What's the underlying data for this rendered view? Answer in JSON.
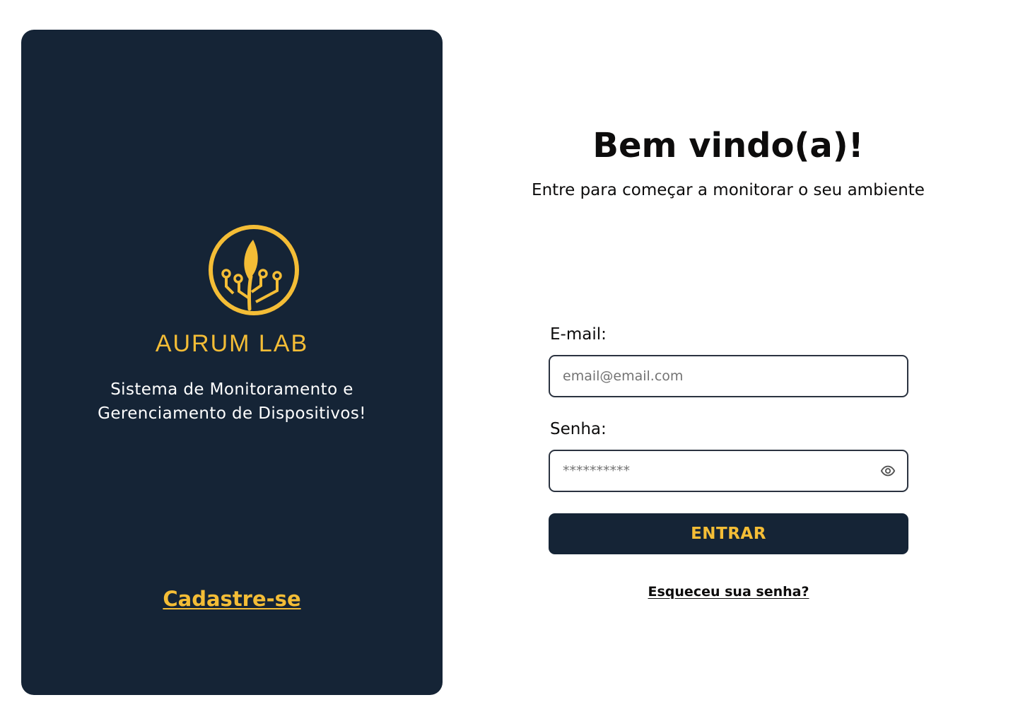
{
  "brand": {
    "name": "AURUM LAB",
    "tagline_line1": "Sistema de Monitoramento e",
    "tagline_line2": "Gerenciamento de Dispositivos!",
    "signup_label": "Cadastre-se",
    "logo_icon": "leaf-circuit-icon",
    "accent_color": "#f4bd36",
    "panel_color": "#152436"
  },
  "login": {
    "title": "Bem vindo(a)!",
    "subtitle": "Entre para começar a monitorar o seu ambiente",
    "email_label": "E-mail:",
    "email_placeholder": "email@email.com",
    "email_value": "",
    "password_label": "Senha:",
    "password_placeholder": "**********",
    "password_value": "",
    "password_toggle_icon": "eye-icon",
    "submit_label": "ENTRAR",
    "forgot_label": "Esqueceu sua senha?"
  }
}
